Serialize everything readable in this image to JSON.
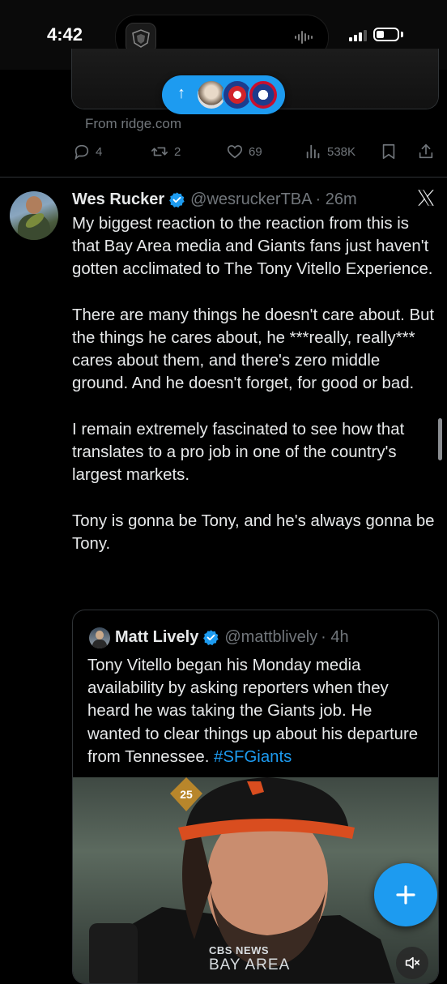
{
  "status_bar": {
    "time": "4:42"
  },
  "previous_post": {
    "source_link": "From ridge.com",
    "replies": "4",
    "reposts": "2",
    "likes": "69",
    "views": "538K"
  },
  "new_posts_pill": {
    "icon": "arrow-up-icon"
  },
  "tweet": {
    "author_name": "Wes Rucker",
    "handle": "@wesruckerTBA",
    "time": "· 26m",
    "text": "My biggest reaction to the reaction from this is that Bay Area media and Giants fans just haven't gotten acclimated to The Tony Vitello Experience.\n\nThere are many things he doesn't care about. But the things he cares about, he ***really, really*** cares about them, and there's zero middle ground. And he doesn't forget, for good or bad.\n\nI remain extremely fascinated to see how that translates to a pro job in one of the country's largest markets.\n\nTony is gonna be Tony, and he's always gonna be Tony."
  },
  "quoted_tweet": {
    "author_name": "Matt Lively",
    "handle": "@mattblively",
    "time": "· 4h",
    "text": "Tony Vitello began his Monday media availability by asking  reporters when they heard he was taking the Giants job. He wanted to clear things up about his departure from Tennessee. ",
    "hashtag": "#SFGiants",
    "media_watermark_top": "CBS NEWS",
    "media_watermark_bottom": "BAY AREA",
    "cap_patch": "25"
  },
  "colors": {
    "accent": "#1d9bf0",
    "background": "#000000",
    "text_primary": "#e7e9ea",
    "text_secondary": "#71767b",
    "border": "#2f3336"
  }
}
